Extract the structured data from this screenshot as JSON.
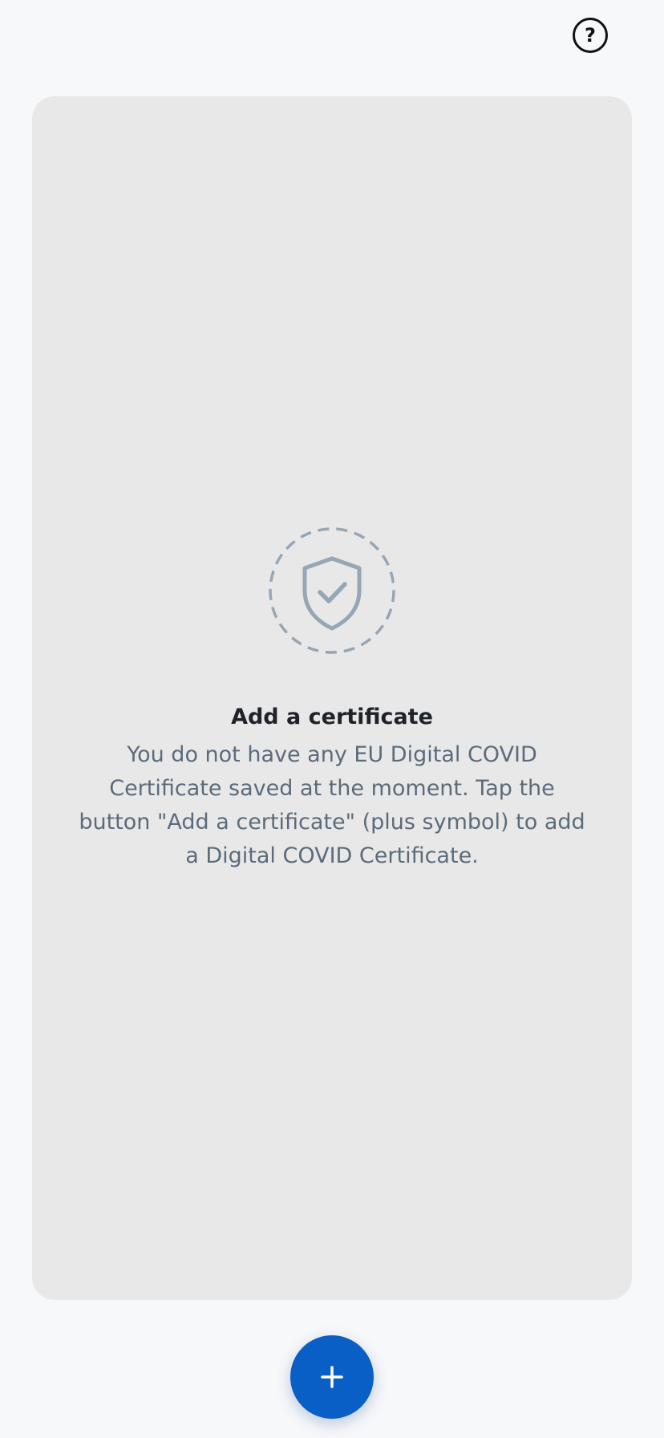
{
  "header": {
    "help_button": {
      "icon": "help-circle-icon",
      "glyph": "?"
    }
  },
  "empty_state": {
    "icon": "shield-check-icon",
    "title": "Add a certificate",
    "message": "You do not have any EU Digital COVID Certificate saved at the moment. Tap the button \"Add a certificate\" (plus symbol) to add a Digital COVID Certificate."
  },
  "fab": {
    "icon": "plus-icon",
    "color": "#0a5fc7"
  },
  "colors": {
    "background": "#f7f8fa",
    "card": "#e8e8e9",
    "icon_gray": "#97a6b4",
    "text_gray": "#5c6b7a",
    "title": "#1f2328"
  }
}
